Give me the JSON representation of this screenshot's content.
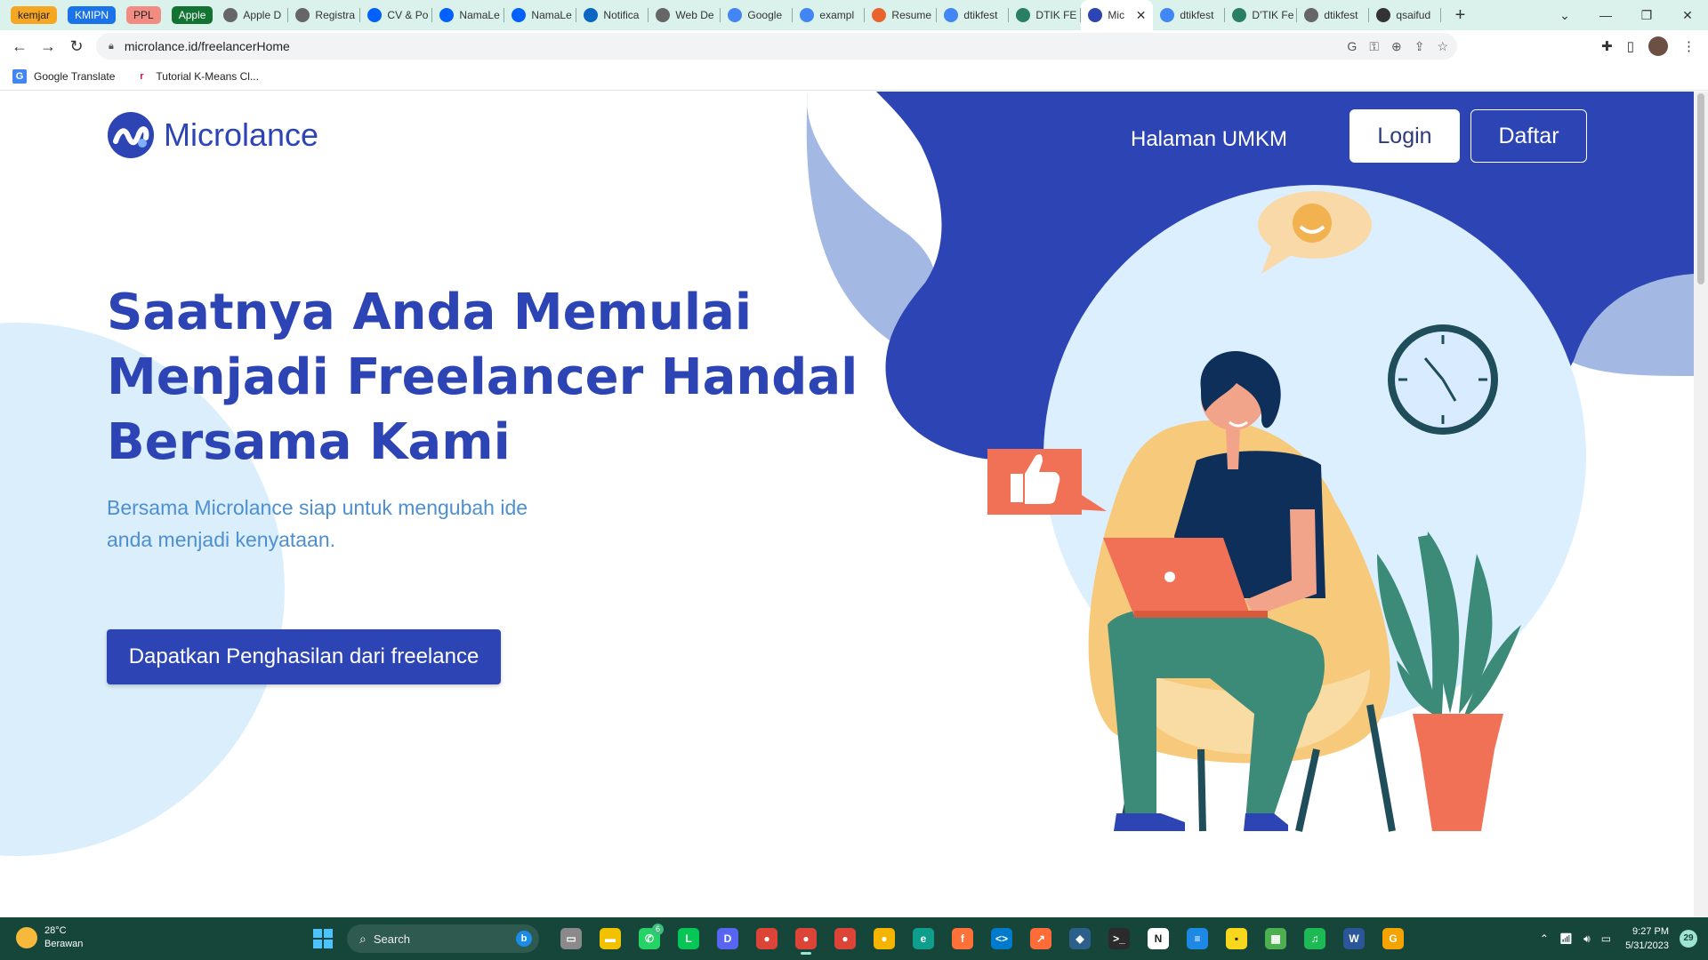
{
  "browser": {
    "tab_groups": [
      {
        "label": "kemjar",
        "color": "#f5a623",
        "text_color": "#222"
      },
      {
        "label": "KMIPN",
        "color": "#1a73e8",
        "text_color": "#fff"
      },
      {
        "label": "PPL",
        "color": "#f28b82",
        "text_color": "#222"
      },
      {
        "label": "Apple",
        "color": "#137333",
        "text_color": "#fff"
      }
    ],
    "tabs": [
      {
        "title": "Apple D",
        "icon": "globe-icon"
      },
      {
        "title": "Registra",
        "icon": "globe-icon"
      },
      {
        "title": "CV & Po",
        "icon": "dropbox-icon"
      },
      {
        "title": "NamaLe",
        "icon": "dropbox-icon"
      },
      {
        "title": "NamaLe",
        "icon": "dropbox-icon"
      },
      {
        "title": "Notifica",
        "icon": "linkedin-icon"
      },
      {
        "title": "Web De",
        "icon": "globe-icon"
      },
      {
        "title": "Google",
        "icon": "google-translate-icon"
      },
      {
        "title": "exampl",
        "icon": "google-icon"
      },
      {
        "title": "Resume",
        "icon": "resume-icon"
      },
      {
        "title": "dtikfest",
        "icon": "google-icon"
      },
      {
        "title": "DTIK FE",
        "icon": "dtik-icon"
      },
      {
        "title": "Mic",
        "icon": "microlance-icon",
        "active": true
      },
      {
        "title": "dtikfest",
        "icon": "google-icon"
      },
      {
        "title": "D'TIK Fe",
        "icon": "dtik-icon"
      },
      {
        "title": "dtikfest",
        "icon": "globe-icon"
      },
      {
        "title": "qsaifud",
        "icon": "github-icon"
      }
    ],
    "url": "microlance.id/freelancerHome",
    "bookmarks": [
      {
        "label": "Google Translate",
        "icon": "google-translate-icon"
      },
      {
        "label": "Tutorial K-Means Cl...",
        "icon": "bookmark-r-icon"
      }
    ]
  },
  "page": {
    "brand": "Microlance",
    "nav": {
      "umkm": "Halaman UMKM",
      "login": "Login",
      "daftar": "Daftar"
    },
    "headline": [
      "Saatnya Anda Memulai",
      "Menjadi Freelancer Handal",
      "Bersama Kami"
    ],
    "subtext": "Bersama Microlance siap untuk mengubah ide anda menjadi kenyataan.",
    "cta": "Dapatkan Penghasilan dari freelance",
    "colors": {
      "brand": "#2d44b5",
      "subtext": "#4d8fd0",
      "hero_blob": "#2d44b5",
      "light_blob": "#dbeefb"
    },
    "illustration": "freelancer-with-laptop-illustration"
  },
  "taskbar": {
    "weather": {
      "temp": "28°C",
      "desc": "Berawan"
    },
    "search_placeholder": "Search",
    "apps": [
      {
        "name": "task-view-icon",
        "color": "#8a8a8a",
        "glyph": "▭"
      },
      {
        "name": "file-explorer-icon",
        "color": "#f2c200",
        "glyph": "▬"
      },
      {
        "name": "whatsapp-icon",
        "color": "#25d366",
        "glyph": "✆",
        "badge": "6"
      },
      {
        "name": "line-icon",
        "color": "#06c755",
        "glyph": "L"
      },
      {
        "name": "discord-icon",
        "color": "#5865f2",
        "glyph": "D"
      },
      {
        "name": "chrome-icon",
        "color": "#db4437",
        "glyph": "●"
      },
      {
        "name": "chrome-profile-icon",
        "color": "#db4437",
        "glyph": "●",
        "active": true
      },
      {
        "name": "chrome-profile-2-icon",
        "color": "#db4437",
        "glyph": "●"
      },
      {
        "name": "chrome-profile-3-icon",
        "color": "#f4b400",
        "glyph": "●"
      },
      {
        "name": "edge-icon",
        "color": "#0f9d8c",
        "glyph": "e"
      },
      {
        "name": "firefox-icon",
        "color": "#ff7139",
        "glyph": "f"
      },
      {
        "name": "vscode-icon",
        "color": "#007acc",
        "glyph": "<>"
      },
      {
        "name": "postman-icon",
        "color": "#ff6c37",
        "glyph": "↗"
      },
      {
        "name": "virtualbox-icon",
        "color": "#2c5f8a",
        "glyph": "◆"
      },
      {
        "name": "terminal-icon",
        "color": "#2b2b2b",
        "glyph": ">_"
      },
      {
        "name": "notion-icon",
        "color": "#ffffff",
        "glyph": "N"
      },
      {
        "name": "notepad-icon",
        "color": "#1e88e5",
        "glyph": "≡"
      },
      {
        "name": "sticky-notes-icon",
        "color": "#f9d71c",
        "glyph": "▪"
      },
      {
        "name": "app-installer-icon",
        "color": "#4caf50",
        "glyph": "▦"
      },
      {
        "name": "spotify-icon",
        "color": "#1db954",
        "glyph": "♫"
      },
      {
        "name": "word-icon",
        "color": "#2b579a",
        "glyph": "W"
      },
      {
        "name": "other-app-icon",
        "color": "#f4a300",
        "glyph": "G"
      }
    ],
    "time": "9:27 PM",
    "date": "5/31/2023",
    "notifications": "29"
  }
}
